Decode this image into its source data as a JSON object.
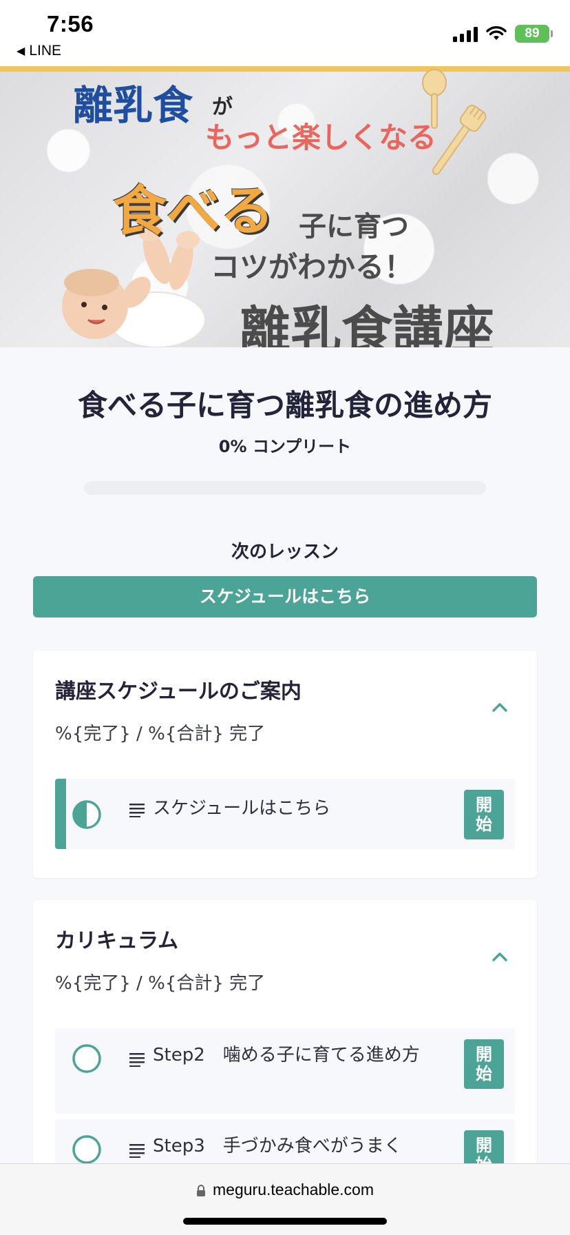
{
  "status_bar": {
    "time": "7:56",
    "back_app": "LINE",
    "battery": "89"
  },
  "hero": {
    "line1": "離乳食",
    "line1_suffix": "が",
    "line2": "もっと楽しくなる",
    "line3_big": "食べる",
    "line3_rest": "子に育つ",
    "line4": "コツがわかる！",
    "line5": "離乳食講座"
  },
  "course": {
    "title": "食べる子に育つ離乳食の進め方",
    "progress_text": "0% コンプリート",
    "progress_value": 0,
    "next_label": "次のレッスン",
    "next_button": "スケジュールはこちら"
  },
  "sections": [
    {
      "title": "講座スケジュールのご案内",
      "subtitle": "%{完了} / %{合計} 完了",
      "lessons": [
        {
          "title": "スケジュールはこちら",
          "status": "in-progress",
          "button": "開始"
        }
      ]
    },
    {
      "title": "カリキュラム",
      "subtitle": "%{完了} / %{合計} 完了",
      "lessons": [
        {
          "title": "Step2　噛める子に育てる進め方",
          "status": "not-started",
          "button": "開始"
        },
        {
          "title": "Step3　手づかみ食べがうまく",
          "status": "not-started",
          "button": "開始"
        }
      ]
    }
  ],
  "browser": {
    "url": "meguru.teachable.com"
  },
  "colors": {
    "accent": "#4ca497",
    "banner_stripe": "#f2c45c"
  }
}
